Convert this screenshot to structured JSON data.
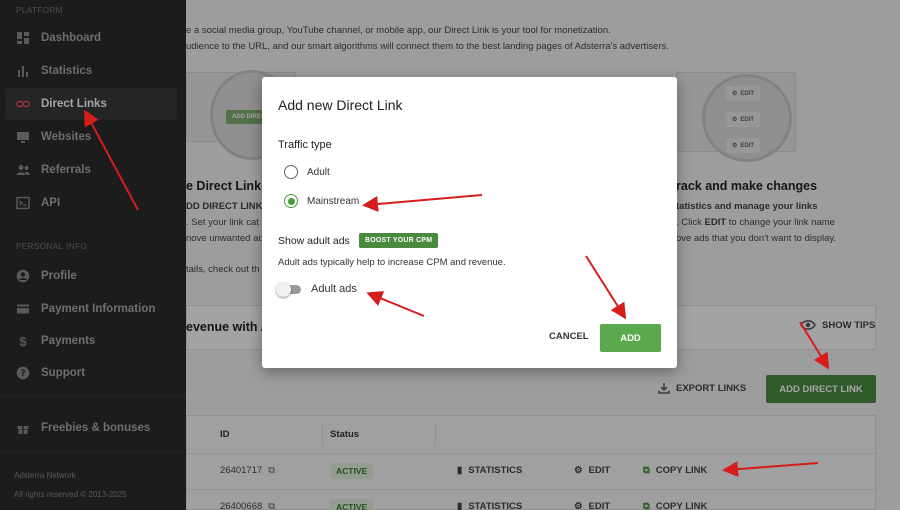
{
  "sidebar": {
    "section_platform": "PLATFORM",
    "items": [
      {
        "label": "Dashboard",
        "icon": "dashboard-icon"
      },
      {
        "label": "Statistics",
        "icon": "bar-chart-icon"
      },
      {
        "label": "Direct Links",
        "icon": "link-icon",
        "active": true
      },
      {
        "label": "Websites",
        "icon": "monitor-icon"
      },
      {
        "label": "Referrals",
        "icon": "users-icon"
      },
      {
        "label": "API",
        "icon": "terminal-icon"
      }
    ],
    "section_personal": "PERSONAL INFO",
    "personal_items": [
      {
        "label": "Profile",
        "icon": "account-circle-icon"
      },
      {
        "label": "Payment Information",
        "icon": "credit-card-icon"
      },
      {
        "label": "Payments",
        "icon": "dollar-icon"
      },
      {
        "label": "Support",
        "icon": "help-icon"
      }
    ],
    "freebies": {
      "label": "Freebies & bonuses",
      "icon": "gift-icon"
    },
    "footer_network": "Adsterra Network",
    "footer_rights": "All rights reserved © 2013-2025"
  },
  "main": {
    "intro_line1": "e a social media group, YouTube channel, or mobile app, our Direct Link is your tool for monetization.",
    "intro_line2": "udience to the URL, and our smart algorithms will connect them to the best landing pages of Adsterra's advertisers.",
    "step1_heading": "e Direct Link",
    "step1_line1": "DD DIRECT LINK",
    "step1_line2": ". Set your link cat",
    "step1_line3": "nove unwanted ad",
    "step1_line4": "tails, check out th",
    "step1_mini": "ADD DIRECT",
    "step3_heading": "rack and make changes",
    "step3_line1": "tatistics and manage your links",
    "step3_line2_pre": ". Click ",
    "step3_line2_bold": "EDIT",
    "step3_line2_post": " to change your link name",
    "step3_line3": "ove ads that you don't want to display.",
    "edit_mini": "EDIT",
    "revenue_heading": "evenue with A",
    "show_tips": "SHOW TIPS",
    "export_links": "EXPORT LINKS",
    "add_direct_link": "ADD DIRECT LINK",
    "table": {
      "col_id": "ID",
      "col_status": "Status",
      "rows": [
        {
          "id": "26401717",
          "status": "ACTIVE",
          "statistics": "STATISTICS",
          "edit": "EDIT",
          "copy": "COPY LINK"
        },
        {
          "id": "26400668",
          "status": "ACTIVE",
          "statistics": "STATISTICS",
          "edit": "EDIT",
          "copy": "COPY LINK"
        }
      ]
    }
  },
  "modal": {
    "title": "Add new Direct Link",
    "traffic_type_label": "Traffic type",
    "options": [
      {
        "label": "Adult",
        "selected": false
      },
      {
        "label": "Mainstream",
        "selected": true
      }
    ],
    "show_adult_label": "Show adult ads",
    "boost_badge": "BOOST YOUR CPM",
    "helper": "Adult ads typically help to increase CPM and revenue.",
    "toggle_label": "Adult ads",
    "toggle_on": false,
    "cancel": "CANCEL",
    "add": "ADD"
  },
  "colors": {
    "sidebar_bg": "#2b2b2b",
    "accent_green": "#4a8a3f",
    "add_green": "#5aaa4d",
    "annotation_red": "#d71c1c"
  }
}
